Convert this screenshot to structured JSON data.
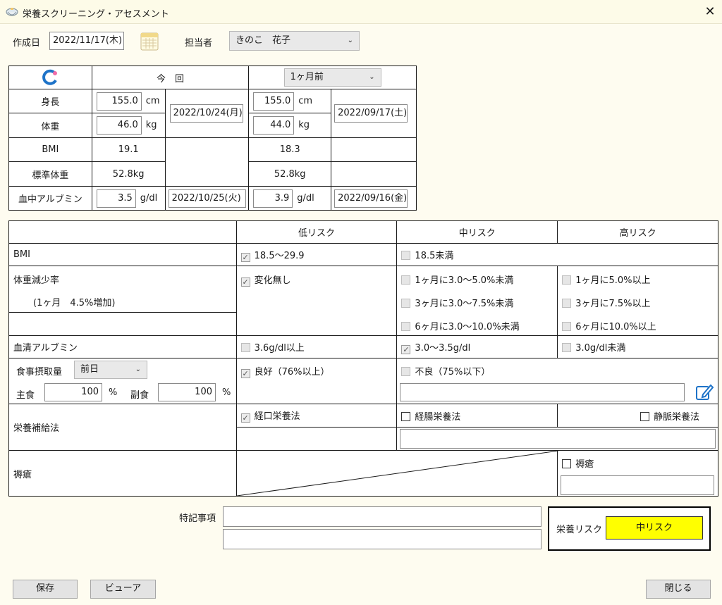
{
  "window": {
    "title": "栄養スクリーニング・アセスメント",
    "close_glyph": "✕"
  },
  "header": {
    "created_label": "作成日",
    "created_value": "2022/11/17(木)",
    "staff_label": "担当者",
    "staff_value": "きのこ　花子"
  },
  "measure": {
    "current_label": "今　回",
    "compare_select": "1ヶ月前",
    "rows": {
      "height": {
        "label": "身長",
        "cur": "155.0",
        "cur_unit": "cm",
        "prev": "155.0",
        "prev_unit": "cm"
      },
      "weight": {
        "label": "体重",
        "cur": "46.0",
        "cur_unit": "kg",
        "prev": "44.0",
        "prev_unit": "kg"
      },
      "bmi": {
        "label": "BMI",
        "cur": "19.1",
        "prev": "18.3"
      },
      "std_weight": {
        "label": "標準体重",
        "cur": "52.8kg",
        "prev": "52.8kg"
      },
      "albumin": {
        "label": "血中アルブミン",
        "cur": "3.5",
        "cur_unit": "g/dl",
        "prev": "3.9",
        "prev_unit": "g/dl",
        "cur_date": "2022/10/25(火)",
        "prev_date": "2022/09/16(金)"
      }
    },
    "cur_date_hw": "2022/10/24(月)",
    "prev_date_hw": "2022/09/17(土)"
  },
  "risk": {
    "headers": [
      "低リスク",
      "中リスク",
      "高リスク"
    ],
    "bmi": {
      "label": "BMI",
      "low": "18.5～29.9",
      "mid": "18.5未満"
    },
    "weight_loss": {
      "label": "体重減少率",
      "detail": "(1ヶ月　4.5%増加)",
      "low": "変化無し",
      "mid": [
        "1ヶ月に3.0～5.0%未満",
        "3ヶ月に3.0～7.5%未満",
        "6ヶ月に3.0～10.0%未満"
      ],
      "high": [
        "1ヶ月に5.0%以上",
        "3ヶ月に7.5%以上",
        "6ヶ月に10.0%以上"
      ]
    },
    "serum_albumin": {
      "label": "血清アルブミン",
      "low": "3.6g/dl以上",
      "mid": "3.0～3.5g/dl",
      "high": "3.0g/dl未満"
    },
    "intake": {
      "label": "食事摂取量",
      "period": "前日",
      "main_label": "主食",
      "main_value": "100",
      "side_label": "副食",
      "side_value": "100",
      "pct": "%",
      "low": "良好（76%以上）",
      "mid": "不良（75%以下）"
    },
    "supplement": {
      "label": "栄養補給法",
      "oral": "経口栄養法",
      "enteral": "経腸栄養法",
      "iv": "静脈栄養法"
    },
    "pressure": {
      "label": "褥瘡",
      "item": "褥瘡"
    }
  },
  "notes": {
    "label": "特記事項"
  },
  "result": {
    "label": "栄養リスク",
    "value": "中リスク",
    "color": "#ffff00"
  },
  "buttons": {
    "save": "保存",
    "viewer": "ビューア",
    "close": "閉じる"
  }
}
